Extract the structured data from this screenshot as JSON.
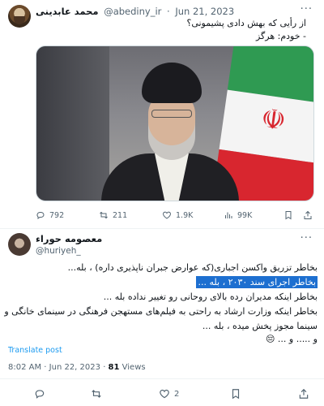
{
  "tweet1": {
    "author_name": "محمد عابدینی",
    "handle": "@abediny_ir",
    "dot": "·",
    "date": "Jun 21, 2023",
    "more": "···",
    "text_line1": "از رأیی که بهش دادی پشیمونی؟",
    "text_line2": "- خودم: هرگز",
    "stats": {
      "replies": "792",
      "retweets": "211",
      "likes": "1.9K",
      "views": "99K"
    }
  },
  "tweet2": {
    "author_name": "معصومه حوراء",
    "handle": "@huriyeh_",
    "more": "···",
    "line1": "بخاطر تزریق واکسن اجباری(که عوارض جبران ناپذیری داره) ، بله...",
    "line2_highlighted": "بخاطر اجرای سند ۲۰۳۰ ، بله ...",
    "line3": "بخاطر اینکه مدیران رده بالای روحانی رو تغییر نداده  بله ...",
    "line4": "بخاطر اینکه وزارت ارشاد به راحتی به فیلم‌های مستهجن فرهنگی در سینمای خانگی و",
    "line5": "سینما مجوز پخش میده ، بله ...",
    "line6": "و ..... و ... 😔",
    "translate_label": "Translate post",
    "time": "8:02 AM",
    "date": "Jun 22, 2023",
    "views_count": "81",
    "views_label": "Views",
    "stats": {
      "likes": "2"
    }
  },
  "colors": {
    "accent": "#1d9bf0",
    "highlight": "#1d6fd0",
    "muted": "#536471"
  }
}
